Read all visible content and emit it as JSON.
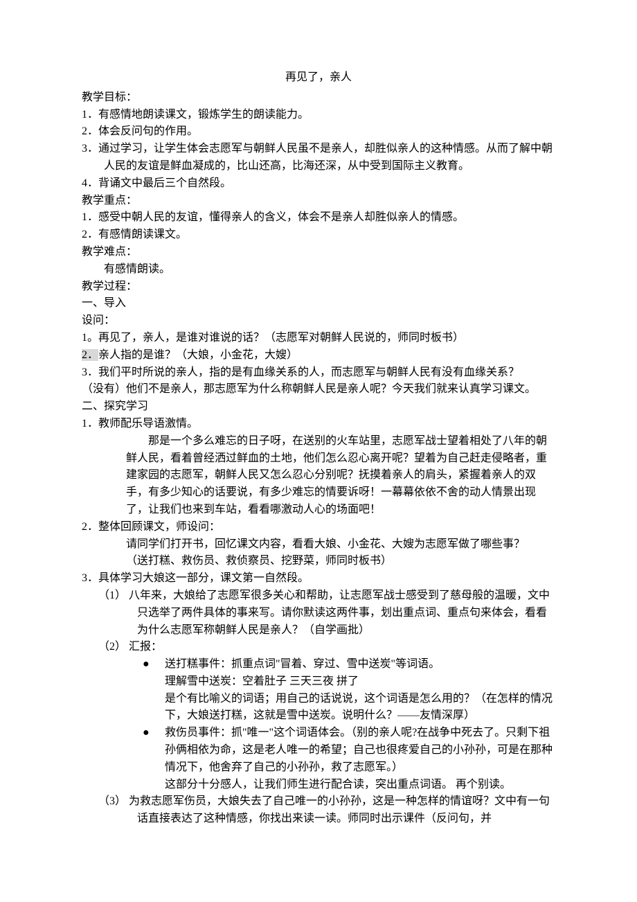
{
  "title": "再见了，亲人",
  "heading_goals": "教学目标：",
  "goals": [
    "1．有感情地朗读课文，锻炼学生的朗读能力。",
    "2．体会反问句的作用。",
    "3．通过学习，让学生体会志愿军与朝鲜人民虽不是亲人，却胜似亲人的这种情感。从而了解中朝人民的友谊是鲜血凝成的，比山还高，比海还深，从中受到国际主义教育。",
    "4．背诵文中最后三个自然段。"
  ],
  "heading_focus": "教学重点：",
  "focus": [
    "1．感受中朝人民的友谊，懂得亲人的含义，体会不是亲人却胜似亲人的情感。",
    "2．有感情朗读课文。"
  ],
  "heading_difficulty": "教学难点：",
  "difficulty_body": "有感情朗读。",
  "heading_process": "教学过程：",
  "section1_heading": "一、导入",
  "section1_sub": "设问：",
  "section1_q1": "1。再见了，亲人，是谁对谁说的话？（志愿军对朝鲜人民说的，师同时板书）",
  "section1_q2_prefix": "2．",
  "section1_q2_body": "亲人指的是谁？（大娘，小金花，大嫂）",
  "section1_q3_l1": "3．我们平时所说的亲人，指的是有血缘关系的人，而志愿军与朝鲜人民有没有血缘关系？",
  "section1_q3_l2": "（没有）他们不是亲人，那志愿军为什么称朝鲜人民是亲人呢？今天我们就来认真学习课文。",
  "section2_heading": "二、探究学习",
  "section2_item1_head": "1．教师配乐导语激情。",
  "section2_item1_body": "那是一个多么难忘的日子呀，在送别的火车站里，志愿军战士望着相处了八年的朝鲜人民，看着曾经洒过鲜血的土地，他们怎么忍心离开呢？望着为自己赶走侵略者，重建家园的志愿军，朝鲜人民又怎么忍心分别呢？抚摸着亲人的肩头，紧握着亲人的双手，有多少知心的话要说，有多少难忘的情要诉呀！一幕幕依依不舍的动人情景出现了，让我们也来到车站，看看哪激动人心的场面吧！",
  "section2_item2_head": "2．整体回顾课文，师设问：",
  "section2_item2_body1": "请同学们打开书，回忆课文内容，看看大娘、小金花、大嫂为志愿军做了哪些事？",
  "section2_item2_body2": "（送打糕、救伤员、救侦察员、挖野菜，师同时板书）",
  "section2_item3_head": "3．具体学习大娘这一部分，课文第一自然段。",
  "section2_item3_sub1_head": "（1）",
  "section2_item3_sub1_body": "八年来，大娘给了志愿军很多关心和帮助，让志愿军战士感受到了慈母般的温暖，文中只选举了两件具体的事来写。请你默读这两件事，划出重点词、重点句来体会，看看为什么志愿军称朝鲜人民是亲人？（自学画批）",
  "section2_item3_sub2_head": "（2）   汇报：",
  "section2_item3_sub2_bullet1_l1": "送打糕事件：抓重点词\"冒着、穿过、雪中送炭\"等词语。",
  "section2_item3_sub2_bullet1_l2": "理解雪中送炭：空着肚子   三天三夜   拼了",
  "section2_item3_sub2_bullet1_l3": "是个有比喻义的词语；用自己的话说说，这个词语是怎么用的？（在怎样的情况下，大娘送打糕，这就是雪中送炭。说明什么？——友情深厚）",
  "section2_item3_sub2_bullet2_l1": "救伤员事件：抓\"唯一\"这个词语体会。（别的亲人呢?在战争中死去了。只剩下祖孙俩相依为命，这是老人唯一的希望；自己也很疼爱自己的小孙孙，可是在那种情况下，他舍弃了自己的小孙孙，救了志愿军。）",
  "section2_item3_sub2_bullet2_l2": "这部分十分感人，让我们师生进行配合读，突出重点词语。    再个别读。",
  "section2_item3_sub3_head": "（3）",
  "section2_item3_sub3_body": "为救志愿军伤员，大娘失去了自己唯一的小孙孙，这是一种怎样的情谊呀？文中有一句话直接表达了这种情感，你找出来读一读。师同时出示课件（反问句，并"
}
